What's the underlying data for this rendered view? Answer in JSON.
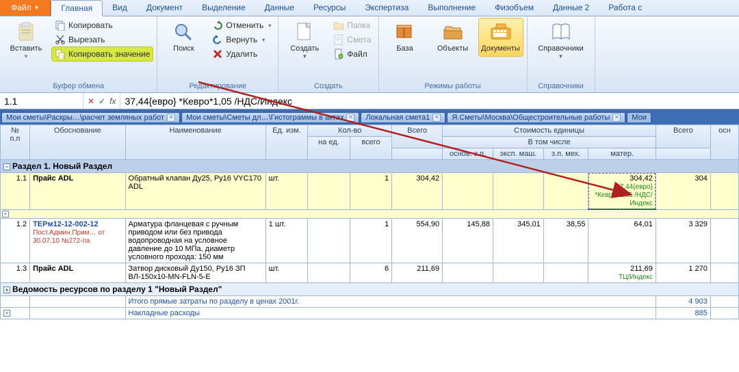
{
  "tabs": {
    "file": "Файл",
    "items": [
      "Главная",
      "Вид",
      "Документ",
      "Выделение",
      "Данные",
      "Ресурсы",
      "Экспертиза",
      "Выполнение",
      "Физобъем",
      "Данные 2",
      "Работа с"
    ],
    "activeIndex": 0
  },
  "ribbon": {
    "clipboard": {
      "paste": "Вставить",
      "copy": "Копировать",
      "cut": "Вырезать",
      "copy_value": "Копировать значение",
      "label": "Буфер обмена"
    },
    "edit": {
      "search": "Поиск",
      "undo": "Отменить",
      "redo": "Вернуть",
      "delete": "Удалить",
      "label": "Редактирование"
    },
    "create": {
      "create": "Создать",
      "folder": "Папка",
      "estimate": "Смета",
      "file": "Файл",
      "label": "Создать"
    },
    "modes": {
      "base": "База",
      "objects": "Объекты",
      "documents": "Документы",
      "label": "Режимы работы"
    },
    "refs": {
      "refs": "Справочники",
      "label": "Справочники"
    }
  },
  "formula": {
    "ref": "1.1",
    "text": "37,44{евро} *Кевро*1,05 /НДС/Индекс"
  },
  "doctabs": [
    "Мои сметы\\Раскры…\\расчет земляных работ",
    "Мои сметы\\Сметы дл…\\Гистограммы в актах",
    "Локальная смета1",
    "Я.Сметы\\Москва\\Общестроительные работы",
    "Мои"
  ],
  "gridhead": {
    "num": "№\nп.п",
    "osn": "Обоснование",
    "naim": "Наименование",
    "ed": "Ед. изм.",
    "kolvo": "Кол-во",
    "naed": "на ед.",
    "vsego1": "всего",
    "vsego2": "Всего",
    "stoim": "Стоимость единицы",
    "vtom": "В том числе",
    "osnzp": "основ. з.п.",
    "eksp": "эксп. маш.",
    "zpmeh": "з.п. мех.",
    "mater": "матер.",
    "vsego3": "Всего",
    "osn2": "осн"
  },
  "rows": {
    "section1": "Раздел 1. Новый Раздел",
    "r1": {
      "num": "1.1",
      "osn": "Прайс ADL",
      "naim": "Обратный клапан Ду25, Ру16 VYC170    ADL",
      "ed": "шт.",
      "vsego1": "1",
      "vsego2": "304,42",
      "mater": "304,42",
      "mater_formula": "37,44{евро} *Кевро*1,05 /НДС/Индекс",
      "total": "304"
    },
    "r2": {
      "num": "1.2",
      "osn": "ТЕРм12-12-002-12",
      "osn_link": "Пост.Админ.Прим… от 30.07.10 №272-па",
      "naim": "Арматура фланцевая с ручным приводом или без привода водопроводная на условное давление до 10 МПа, диаметр условного прохода: 150 мм",
      "ed": "1 шт.",
      "vsego1": "1",
      "vsego2": "554,90",
      "osnzp": "145,88",
      "eksp": "345,01",
      "zpmeh": "38,55",
      "mater": "64,01",
      "total": "3 329"
    },
    "r3": {
      "num": "1.3",
      "osn": "Прайс ADL",
      "naim": "Затвор дисковый Ду150, Ру16 ЗП ВЛ-150х10-MN-FLN-5-E",
      "ed": "шт.",
      "vsego1": "6",
      "vsego2": "211,69",
      "mater": "211,69",
      "mater_note": "ТЦ/Индекс",
      "total": "1 270"
    },
    "vedomost": "Ведомость ресурсов по разделу 1 \"Новый Раздел\"",
    "itogo": "Итого прямые затраты по разделу в ценах 2001г.",
    "itogo_val": "4 903",
    "nakl": "Накладные расходы",
    "nakl_val": "885"
  }
}
